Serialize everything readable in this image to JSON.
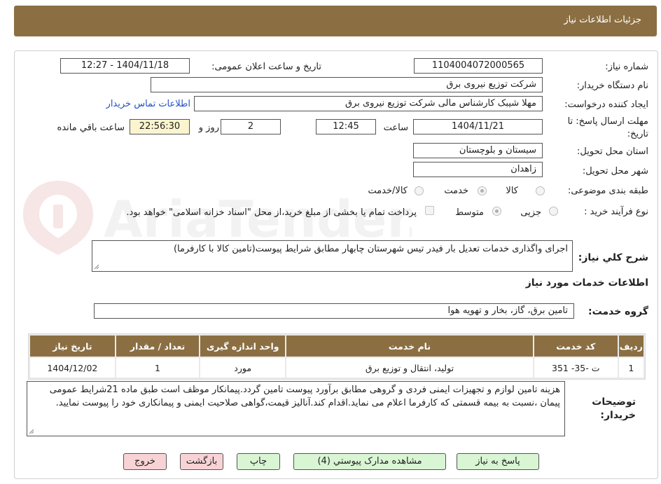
{
  "header": {
    "title": "جزئیات اطلاعات نیاز"
  },
  "form": {
    "need_number": {
      "label": "شماره نیاز:",
      "value": "1104004072000565"
    },
    "announce_datetime": {
      "label": "تاریخ و ساعت اعلان عمومی:",
      "value": "1404/11/18 - 12:27"
    },
    "buyer_org": {
      "label": "نام دستگاه خریدار:",
      "value": "شرکت توزیع نیروی برق"
    },
    "requester": {
      "label": "ایجاد کننده درخواست:",
      "value": "مهلا شیبک کارشناس مالی شرکت توزیع نیروی برق",
      "contact_link": "اطلاعات تماس خریدار"
    },
    "deadline": {
      "label_line1": "مهلت ارسال پاسخ: تا",
      "label_line2": "تاریخ:",
      "date": "1404/11/21",
      "time_label": "ساعت",
      "time": "12:45",
      "days": "2",
      "days_label": "روز و",
      "remaining": "22:56:30",
      "remaining_label": "ساعت باقي مانده"
    },
    "province": {
      "label": "استان محل تحویل:",
      "value": "سیستان و بلوچستان"
    },
    "city": {
      "label": "شهر محل تحویل:",
      "value": "زاهدان"
    },
    "category": {
      "label": "طبقه بندی موضوعی:",
      "options": [
        "کالا",
        "خدمت",
        "کالا/خدمت"
      ],
      "selected": "خدمت"
    },
    "process": {
      "label": "نوع فرآیند خرید :",
      "options": [
        "جزیی",
        "متوسط"
      ],
      "selected": "متوسط",
      "treasury_note": "پرداخت تمام یا بخشی از مبلغ خرید،از محل \"اسناد خزانه اسلامی\" خواهد بود."
    },
    "summary": {
      "label": "شرح کلي نياز:",
      "value": "اجرای واگذاری خدمات تعدیل بار فیدر تیس شهرستان چابهار مطابق شرایط پیوست(تامین کالا با کارفرما)"
    }
  },
  "services": {
    "section_title": "اطلاعات خدمات مورد نياز",
    "group_label": "گروه خدمت:",
    "group_value": "تامین برق، گاز، بخار و تهویه هوا",
    "table": {
      "headers": [
        "رديف",
        "کد خدمت",
        "نام خدمت",
        "واحد اندازه گیری",
        "تعداد / مقدار",
        "تاریخ نیاز"
      ],
      "rows": [
        [
          "1",
          "ت -35- 351",
          "تولید، انتقال و توزیع برق",
          "مورد",
          "1",
          "1404/12/02"
        ]
      ]
    }
  },
  "buyer_notes": {
    "label_line1": "توضیحات",
    "label_line2": "خریدار:",
    "value": "هزینه تامین لوازم و تجهیزات ایمنی فردی و گروهی مطابق برآورد پیوست تامین گردد.پیمانکار موظف است طبق ماده 21شرایط عمومی پیمان ،نسبت به بیمه قسمتی که کارفرما اعلام می نماید.اقدام کند.آنالیز قیمت،گواهی صلاحیت ایمنی و پیمانکاری خود را پیوست نمایید."
  },
  "buttons": {
    "reply": "پاسخ به نیاز",
    "view_docs": "مشاهده مدارک پیوستي (4)",
    "print": "چاپ",
    "back": "بازگشت",
    "exit": "خروج"
  },
  "watermark": {
    "text": "AriaTender.neT"
  },
  "colors": {
    "header": "#8b6f42",
    "link": "#2250c8",
    "green_button": "#d9f5d4",
    "pink_button": "#f8d3d6",
    "remaining_bg": "#fbf5cf"
  }
}
